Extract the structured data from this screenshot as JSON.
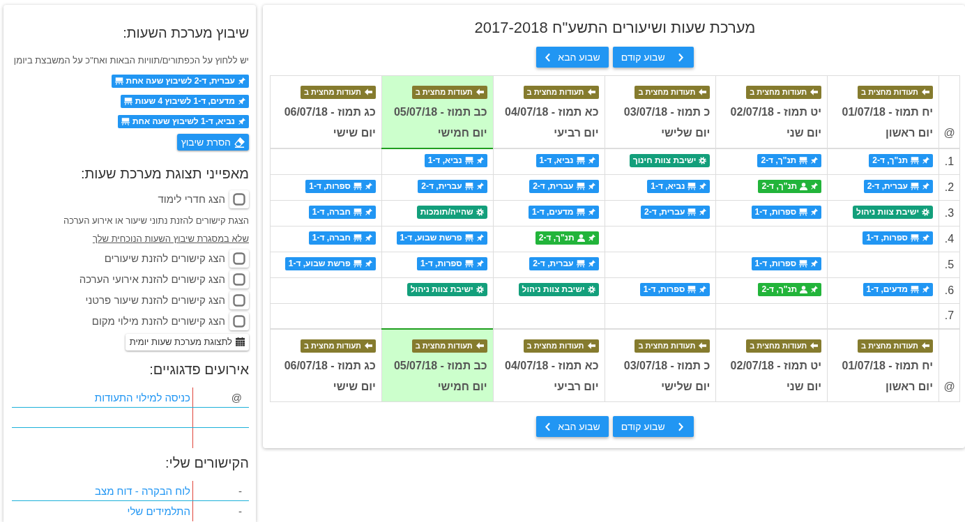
{
  "sidebar": {
    "scheduling": {
      "title": "שיבוץ מערכת השעות:",
      "hint": "יש ללחוץ על הכפתורים/תוויות הבאות ואח\"כ על המשבצת ביומן",
      "items": [
        "עברית, ד-2 לשיבוץ שעה אחת",
        "מדעים, ד-1 לשיבוץ 4 שעות",
        "נביא, ד-1 לשיבוץ שעה אחת"
      ],
      "clear_button": "הסרת שיבוץ"
    },
    "display_options": {
      "title": "מאפייני תצוגת מערכת שעות:",
      "items": [
        {
          "kind": "checkbox",
          "label": "הצג חדרי לימוד",
          "checked": false
        },
        {
          "kind": "note",
          "text": "הצגת קישורים להזנת נתוני שיעור או אירוע הערכה"
        },
        {
          "kind": "underlined",
          "text": "שלא במסגרת שיבוץ השעות הנוכחית שלך"
        },
        {
          "kind": "checkbox",
          "label": "הצג קישורים להזנת שיעורים",
          "checked": false
        },
        {
          "kind": "checkbox",
          "label": "הצג קישורים להזנת אירועי הערכה",
          "checked": false
        },
        {
          "kind": "checkbox",
          "label": "הצג קישורים להזנת שיעור פרטני",
          "checked": false
        },
        {
          "kind": "checkbox",
          "label": "הצג קישורים להזנת מילוי מקום",
          "checked": false
        }
      ],
      "daily_view_button": "לתצוגת מערכת שעות יומית"
    },
    "pedagogic_events": {
      "title": "אירועים פדגוגיים:",
      "rows": [
        {
          "marker": "@",
          "link": "כניסה למילוי התעודות"
        }
      ]
    },
    "my_links": {
      "title": "הקישורים שלי:",
      "rows": [
        {
          "marker": "-",
          "link": "לוח הבקרה - דוח מצב"
        },
        {
          "marker": "-",
          "link": "התלמידים שלי"
        }
      ]
    }
  },
  "timetable": {
    "title": "מערכת שעות ושיעורים התשע\"ח 2017-2018",
    "nav_top": [
      {
        "kind": "prev",
        "label": "שבוע קודם"
      },
      {
        "kind": "next",
        "label": "שבוע הבא"
      }
    ],
    "corner_top": "@",
    "header_days": [
      {
        "badge": "תעודות מחצית ב",
        "date": "יח תמוז - 01/07/18",
        "day": "יום ראשון",
        "today": false
      },
      {
        "badge": "תעודות מחצית ב",
        "date": "יט תמוז - 02/07/18",
        "day": "יום שני",
        "today": false
      },
      {
        "badge": "תעודות מחצית ב",
        "date": "כ תמוז - 03/07/18",
        "day": "יום שלישי",
        "today": false
      },
      {
        "badge": "תעודות מחצית ב",
        "date": "כא תמוז - 04/07/18",
        "day": "יום רביעי",
        "today": false
      },
      {
        "badge": "תעודות מחצית ב",
        "date": "כב תמוז - 05/07/18",
        "day": "יום חמישי",
        "today": true
      },
      {
        "badge": "תעודות מחצית ב",
        "date": "כג תמוז - 06/07/18",
        "day": "יום שישי",
        "today": false
      }
    ],
    "rows": [
      {
        "number": "1.",
        "cells": [
          {
            "kind": "lesson",
            "text": "תנ\"ך, ד-2"
          },
          {
            "kind": "lesson",
            "text": "תנ\"ך, ד-2"
          },
          {
            "kind": "meeting",
            "text": "ישיבת צוות חינוך"
          },
          {
            "kind": "lesson",
            "text": "נביא, ד-1"
          },
          {
            "kind": "lesson",
            "text": "נביא, ד-1"
          },
          null
        ]
      },
      {
        "number": "2.",
        "cells": [
          {
            "kind": "lesson",
            "text": "עברית, ד-2"
          },
          {
            "kind": "private",
            "text": "תנ\"ך, ד-2"
          },
          {
            "kind": "lesson",
            "text": "נביא, ד-1"
          },
          {
            "kind": "lesson",
            "text": "עברית, ד-2"
          },
          {
            "kind": "lesson",
            "text": "עברית, ד-2"
          },
          {
            "kind": "lesson",
            "text": "ספרות, ד-1"
          }
        ]
      },
      {
        "number": "3.",
        "cells": [
          {
            "kind": "meeting",
            "text": "ישיבת צוות ניהול"
          },
          {
            "kind": "lesson",
            "text": "ספרות, ד-1"
          },
          {
            "kind": "lesson",
            "text": "עברית, ד-2"
          },
          {
            "kind": "lesson",
            "text": "מדעים, ד-1"
          },
          {
            "kind": "meeting",
            "text": "שהייה/תומכות"
          },
          {
            "kind": "lesson",
            "text": "חברה, ד-1"
          }
        ]
      },
      {
        "number": "4.",
        "cells": [
          {
            "kind": "lesson",
            "text": "ספרות, ד-1"
          },
          null,
          null,
          {
            "kind": "private",
            "text": "תנ\"ך, ד-2"
          },
          {
            "kind": "lesson",
            "text": "פרשת שבוע, ד-1"
          },
          {
            "kind": "lesson",
            "text": "חברה, ד-1"
          }
        ]
      },
      {
        "number": "5.",
        "cells": [
          null,
          {
            "kind": "lesson",
            "text": "ספרות, ד-1"
          },
          null,
          {
            "kind": "lesson",
            "text": "עברית, ד-2"
          },
          {
            "kind": "lesson",
            "text": "ספרות, ד-1"
          },
          {
            "kind": "lesson",
            "text": "פרשת שבוע, ד-1"
          }
        ]
      },
      {
        "number": "6.",
        "cells": [
          {
            "kind": "lesson",
            "text": "מדעים, ד-1"
          },
          {
            "kind": "private",
            "text": "תנ\"ך, ד-2"
          },
          {
            "kind": "lesson",
            "text": "ספרות, ד-1"
          },
          {
            "kind": "meeting",
            "text": "ישיבת צוות ניהול"
          },
          {
            "kind": "meeting",
            "text": "ישיבת צוות ניהול"
          },
          null
        ]
      },
      {
        "number": "7.",
        "cells": [
          null,
          null,
          null,
          null,
          null,
          null
        ]
      }
    ],
    "corner_bottom": "@",
    "footer_days": [
      {
        "badge": "תעודות מחצית ב",
        "date": "יח תמוז - 01/07/18",
        "day": "יום ראשון",
        "today": false
      },
      {
        "badge": "תעודות מחצית ב",
        "date": "יט תמוז - 02/07/18",
        "day": "יום שני",
        "today": false
      },
      {
        "badge": "תעודות מחצית ב",
        "date": "כ תמוז - 03/07/18",
        "day": "יום שלישי",
        "today": false
      },
      {
        "badge": "תעודות מחצית ב",
        "date": "כא תמוז - 04/07/18",
        "day": "יום רביעי",
        "today": false
      },
      {
        "badge": "תעודות מחצית ב",
        "date": "כב תמוז - 05/07/18",
        "day": "יום חמישי",
        "today": true
      },
      {
        "badge": "תעודות מחצית ב",
        "date": "כג תמוז - 06/07/18",
        "day": "יום שישי",
        "today": false
      }
    ],
    "nav_bottom": [
      {
        "kind": "prev",
        "label": "שבוע קודם"
      },
      {
        "kind": "next",
        "label": "שבוע הבא"
      }
    ]
  }
}
